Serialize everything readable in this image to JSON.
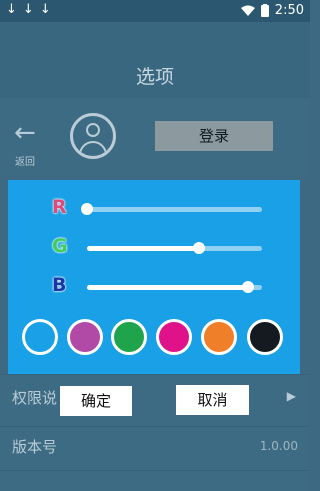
{
  "status_bar": {
    "download_icons": [
      "↓",
      "↓",
      "↓"
    ],
    "time": "2:50"
  },
  "title": "选项",
  "back": {
    "label": "返回"
  },
  "login_label": "登录",
  "rows": {
    "permission": {
      "label": "权限说"
    },
    "version": {
      "label": "版本号",
      "value": "1.0.00"
    }
  },
  "rgb": {
    "r_letter": "R",
    "g_letter": "G",
    "b_letter": "B",
    "r_value": 0,
    "g_value": 0.64,
    "b_value": 0.92
  },
  "swatches": [
    "#1aa0e6",
    "#b04aa6",
    "#1fa34b",
    "#e0128a",
    "#f07f2a",
    "#141a20"
  ],
  "confirm_label": "确定",
  "cancel_label": "取消",
  "colors": {
    "accent": "#1aa0e6",
    "r_color": "#e04a78",
    "g_color": "#3ecf5a",
    "b_color": "#1838a6"
  }
}
